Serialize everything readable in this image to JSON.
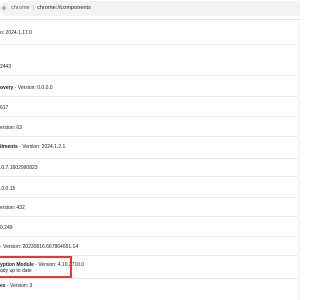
{
  "browser": {
    "url_scheme": "chrome",
    "url_separator": "|",
    "url_path": "chrome://components"
  },
  "components": [
    {
      "name": "",
      "version_text": "o: 2024.1.17.0",
      "status": ""
    },
    {
      "name": "",
      "version_text": "2443",
      "status": ""
    },
    {
      "name": "overy",
      "version_text": " - Version: 0.0.0.0",
      "status": ""
    },
    {
      "name": "",
      "version_text": "617",
      "status": ""
    },
    {
      "name": "",
      "version_text": "ersion: 63",
      "status": ""
    },
    {
      "name": "itments",
      "version_text": " - Version: 2024.1.2.1",
      "status": ""
    },
    {
      "name": "",
      "version_text": ".0.7.1602990823",
      "status": ""
    },
    {
      "name": "",
      "version_text": ".0.0.15",
      "status": ""
    },
    {
      "name": "",
      "version_text": "ersion: 432",
      "status": ""
    },
    {
      "name": "",
      "version_text": "0.249",
      "status": ""
    },
    {
      "name": "",
      "version_text": "- Version: 20230816.667864661.14",
      "status": ""
    },
    {
      "name": "yption Module",
      "version_text": " - Version: 4.10.2710.0",
      "status": "ady up to date"
    },
    {
      "name": "es",
      "version_text": " - Version: 3",
      "status": ""
    }
  ],
  "colors": {
    "highlight": "#e53935",
    "divider": "#ececec"
  }
}
